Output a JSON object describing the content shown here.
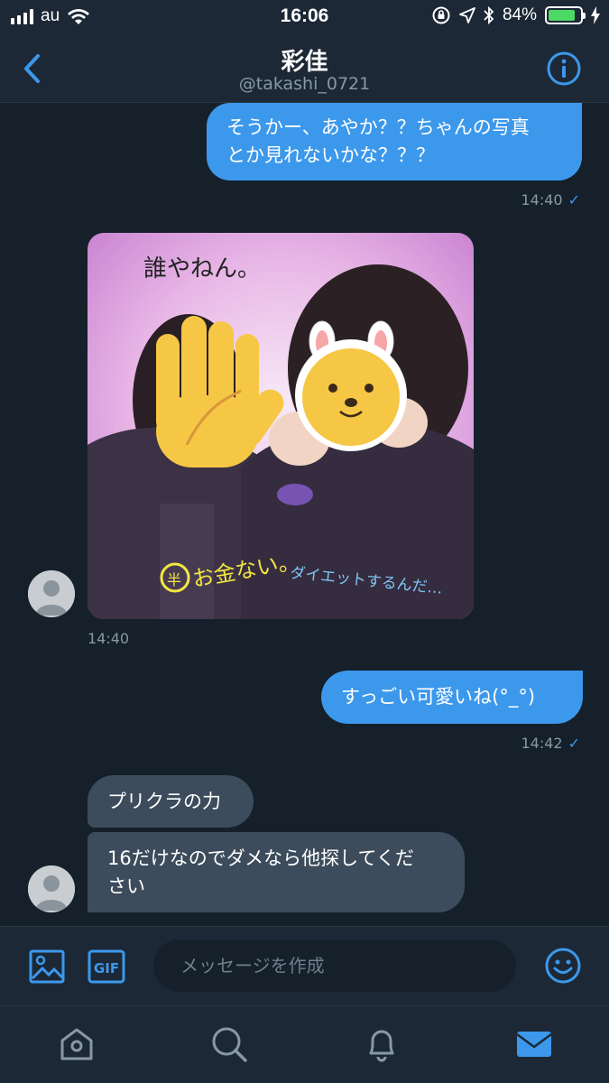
{
  "status_bar": {
    "carrier": "au",
    "time": "16:06",
    "battery": "84%",
    "battery_level": 0.84
  },
  "header": {
    "title": "彩佳",
    "handle": "@takashi_0721",
    "back_icon": "chevron-left-icon",
    "info_icon": "info-icon"
  },
  "messages": [
    {
      "direction": "out",
      "lines": [
        "そうかー、あやか？？ちゃんの写真",
        "とか見れないかな？？？"
      ],
      "time": "14:40",
      "check": "✓"
    },
    {
      "direction": "in",
      "type": "image",
      "time": "14:40",
      "image_text": {
        "top": "誰やねん。",
        "left": "お金ない。",
        "right": "ダイエットするんだ…",
        "circle": "半"
      }
    },
    {
      "direction": "out",
      "lines": [
        "すっごい可愛いね(°_°)"
      ],
      "time": "14:42",
      "check": "✓"
    },
    {
      "direction": "in",
      "lines": [
        "プリクラの力"
      ]
    },
    {
      "direction": "in",
      "lines": [
        "16だけなのでダメなら他探してくだ",
        "さい"
      ]
    }
  ],
  "composer": {
    "placeholder": "メッセージを作成",
    "gif_label": "GIF"
  },
  "tabbar": [
    "home-icon",
    "search-icon",
    "bell-icon",
    "mail-icon"
  ],
  "colors": {
    "background": "#15202b",
    "bar": "#1c2836",
    "accent": "#3c98eb",
    "incoming_bubble": "#3d4c5c",
    "muted_text": "#8899a6"
  }
}
